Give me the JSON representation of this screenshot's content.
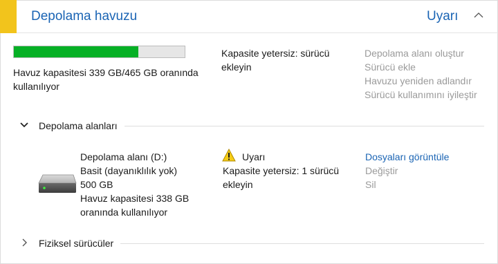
{
  "pool": {
    "title": "Depolama havuzu",
    "status": "Uyarı",
    "usage_fraction": 0.73,
    "usage_text": "Havuz kapasitesi 339 GB/465 GB oranında kullanılıyor",
    "capacity_warning": "Kapasite yetersiz: sürücü ekleyin",
    "actions": [
      "Depolama alanı oluştur",
      "Sürücü ekle",
      "Havuzu yeniden adlandır",
      "Sürücü kullanımını iyileştir"
    ]
  },
  "spaces_section": {
    "label": "Depolama alanları",
    "space": {
      "name": "Depolama alanı (D:)",
      "resiliency": "Basit (dayanıklılık yok)",
      "size": "500 GB",
      "pool_usage": "Havuz kapasitesi 338 GB oranında kullanılıyor",
      "status": "Uyarı",
      "status_detail": "Kapasite yetersiz: 1 sürücü ekleyin",
      "actions": {
        "view_files": "Dosyaları görüntüle",
        "change": "Değiştir",
        "delete": "Sil"
      }
    }
  },
  "drives_section": {
    "label": "Fiziksel sürücüler"
  },
  "colors": {
    "accent": "#1a64b4",
    "warning_strip": "#f2c41c",
    "usage_bar": "#06b025",
    "disabled_link": "#9a9a9a"
  },
  "icons": {
    "collapse": "chevron-up-icon",
    "spaces_toggle": "chevron-down-icon",
    "drives_toggle": "chevron-right-icon",
    "drive": "hard-drive-icon",
    "warning": "warning-triangle-icon"
  }
}
